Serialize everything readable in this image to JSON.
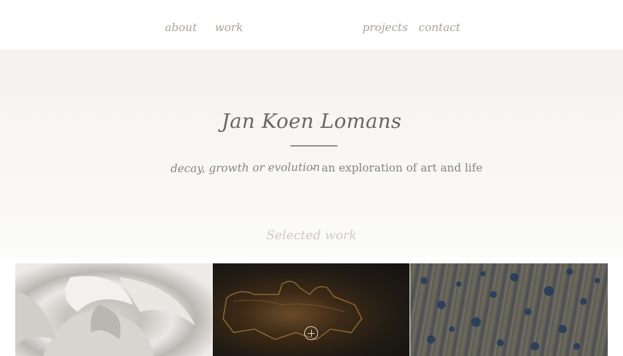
{
  "nav": {
    "items": [
      {
        "label": "about"
      },
      {
        "label": "work"
      },
      {
        "label": "projects"
      },
      {
        "label": "contact"
      }
    ]
  },
  "hero": {
    "title": "Jan Koen Lomans",
    "tagline_part1": "decay, growth or evolution",
    "tagline_separator": "-",
    "tagline_part2": "an exploration of art and life"
  },
  "gallery": {
    "heading": "Selected work",
    "tiles": [
      {
        "icon": "paper-sculpture-image"
      },
      {
        "icon": "zoom-plus-icon"
      },
      {
        "icon": "textured-painting-image"
      }
    ]
  }
}
